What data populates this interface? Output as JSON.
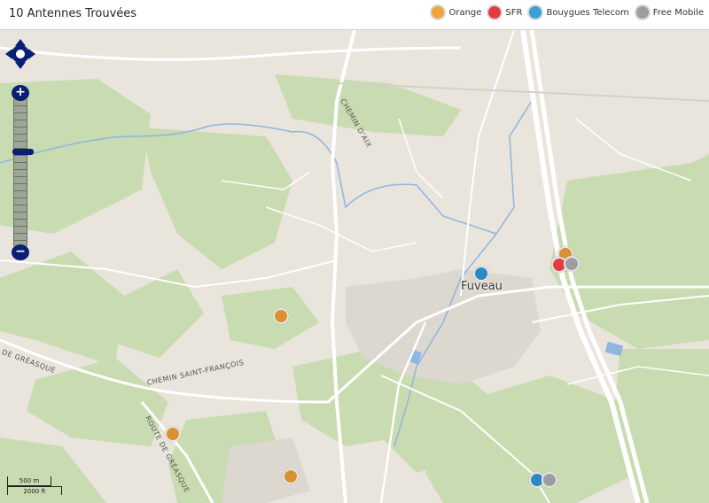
{
  "header": {
    "title": "10 Antennes Trouvées"
  },
  "legend": [
    {
      "label": "Orange",
      "color": "#f0a53c"
    },
    {
      "label": "SFR",
      "color": "#e23b44"
    },
    {
      "label": "Bouygues Telecom",
      "color": "#3aa0d8"
    },
    {
      "label": "Free Mobile",
      "color": "#9e9e9e"
    }
  ],
  "map": {
    "town": "Fuveau",
    "labels": [
      "CHEMIN D'AIX",
      "CHEMIN SAINT-FRANÇOIS",
      "DE GRÉASQUE",
      "ROUTE DE GRÉASQUE"
    ],
    "scale": {
      "metric": "500 m",
      "imperial": "2000 ft"
    }
  },
  "controls": {
    "zoom_in": "+",
    "zoom_out": "−"
  }
}
